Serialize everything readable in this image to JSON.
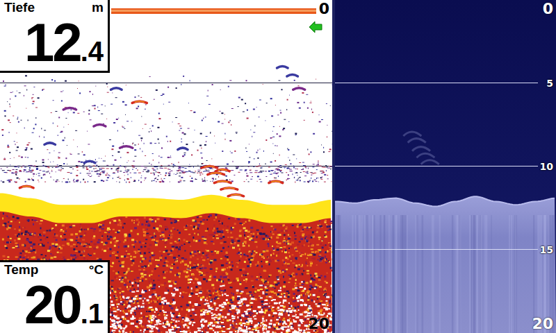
{
  "depth": {
    "label": "Tiefe",
    "unit": "m",
    "whole": "12",
    "decimal": ".4"
  },
  "temperature": {
    "label": "Temp",
    "unit": "°C",
    "whole": "20",
    "decimal": ".1"
  },
  "sonar": {
    "range_top": "0",
    "range_bottom": "20",
    "max_depth_m": 20,
    "grid_depths_m": [
      5,
      10
    ],
    "bottom_depths_m": [
      11.6,
      11.9,
      12.3,
      12.3,
      11.9,
      11.9,
      12.0,
      11.7,
      12.0,
      12.3,
      12.3,
      12.0
    ],
    "fish": [
      {
        "ping": 85,
        "depth": 4.0,
        "strength": 0.4
      },
      {
        "ping": 88,
        "depth": 4.5,
        "strength": 0.4
      },
      {
        "ping": 42,
        "depth": 6.1,
        "strength": 0.8
      },
      {
        "ping": 21,
        "depth": 6.5,
        "strength": 0.6
      },
      {
        "ping": 90,
        "depth": 5.3,
        "strength": 0.5
      },
      {
        "ping": 30,
        "depth": 7.5,
        "strength": 0.5
      },
      {
        "ping": 38,
        "depth": 8.8,
        "strength": 0.6
      },
      {
        "ping": 15,
        "depth": 8.6,
        "strength": 0.4
      },
      {
        "ping": 27,
        "depth": 9.7,
        "strength": 0.4
      },
      {
        "ping": 55,
        "depth": 8.9,
        "strength": 0.3
      },
      {
        "ping": 35,
        "depth": 5.3,
        "strength": 0.4
      },
      {
        "ping": 62,
        "depth": 10.0,
        "strength": 0.3
      },
      {
        "ping": 83,
        "depth": 10.9,
        "strength": 0.7
      },
      {
        "ping": 67,
        "depth": 10.2,
        "strength": 0.7
      },
      {
        "ping": 63,
        "depth": 10.0,
        "strength": 0.9
      },
      {
        "ping": 65,
        "depth": 10.4,
        "strength": 1.0
      },
      {
        "ping": 67,
        "depth": 10.9,
        "strength": 1.0
      },
      {
        "ping": 69,
        "depth": 11.3,
        "strength": 1.0
      },
      {
        "ping": 71,
        "depth": 11.7,
        "strength": 0.9
      },
      {
        "ping": 8,
        "depth": 11.2,
        "strength": 0.7
      }
    ]
  },
  "down_imaging": {
    "range_top": "0",
    "range_bottom": "20",
    "max_depth_m": 20,
    "ticks": [
      {
        "label": "5",
        "depth": 5
      },
      {
        "label": "10",
        "depth": 10
      },
      {
        "label": "15",
        "depth": 15
      }
    ],
    "bottom_depths_m": [
      12.1,
      12.2,
      12.0,
      11.9,
      12.2,
      12.4,
      12.1,
      11.8,
      12.1,
      12.3,
      12.1,
      11.9
    ]
  }
}
